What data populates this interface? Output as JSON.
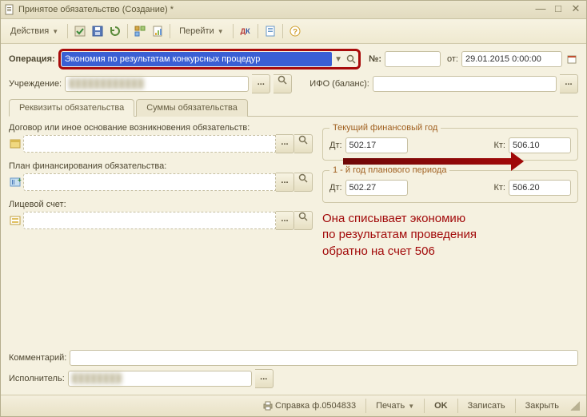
{
  "window": {
    "title": "Принятое обязательство (Создание) *"
  },
  "toolbar": {
    "actions_label": "Действия",
    "goto_label": "Перейти"
  },
  "header": {
    "operation_label": "Операция:",
    "operation_value": "Экономия по результатам конкурсных процедур",
    "number_label": "№:",
    "number_value": "",
    "date_label": "от:",
    "date_value": "29.01.2015 0:00:00",
    "org_label": "Учреждение:",
    "org_value": "",
    "ifo_label": "ИФО (баланс):",
    "ifo_value": ""
  },
  "tabs": {
    "tab1": "Реквизиты обязательства",
    "tab2": "Суммы обязательства"
  },
  "fields": {
    "basis_label": "Договор или иное основание возникновения обязательств:",
    "basis_value": "",
    "plan_label": "План финансирования обязательства:",
    "plan_value": "",
    "account_label": "Лицевой счет:",
    "account_value": ""
  },
  "year_current": {
    "legend": "Текущий финансовый год",
    "dt_label": "Дт:",
    "dt_value": "502.17",
    "kt_label": "Кт:",
    "kt_value": "506.10"
  },
  "year_plan1": {
    "legend": "1 - й год планового периода",
    "dt_label": "Дт:",
    "dt_value": "502.27",
    "kt_label": "Кт:",
    "kt_value": "506.20"
  },
  "note": {
    "line1": "Она списывает экономию",
    "line2": "по результатам проведения",
    "line3": "обратно на счет 506"
  },
  "bottom": {
    "comment_label": "Комментарий:",
    "comment_value": "",
    "executor_label": "Исполнитель:",
    "executor_value": ""
  },
  "statusbar": {
    "ref_label": "Справка ф.0504833",
    "print_label": "Печать",
    "ok_label": "OK",
    "save_label": "Записать",
    "close_label": "Закрыть"
  }
}
